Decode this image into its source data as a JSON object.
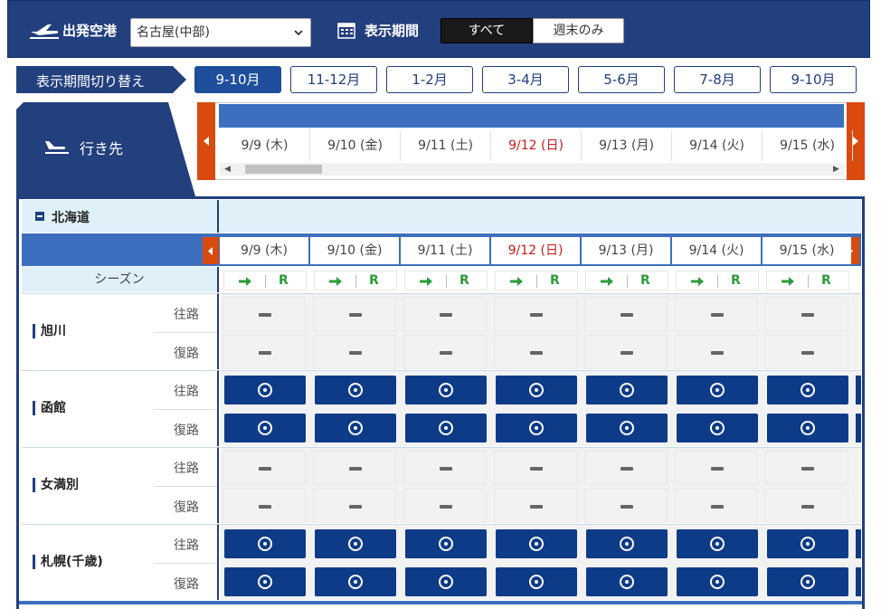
{
  "header": {
    "departure_label": "出発空港",
    "airport_value": "名古屋(中部)",
    "period_label": "表示期間",
    "toggle": [
      "すべて",
      "週末のみ"
    ],
    "toggle_active": "すべて"
  },
  "period_switch": {
    "label": "表示期間切り替え",
    "buttons": [
      "9-10月",
      "11-12月",
      "1-2月",
      "3-4月",
      "5-6月",
      "7-8月",
      "9-10月"
    ],
    "active_index": 0
  },
  "destination_tab": {
    "label": "行き先"
  },
  "dates": [
    {
      "label": "9/9 (木)",
      "sunday": false
    },
    {
      "label": "9/10 (金)",
      "sunday": false
    },
    {
      "label": "9/11 (土)",
      "sunday": false
    },
    {
      "label": "9/12 (日)",
      "sunday": true
    },
    {
      "label": "9/13 (月)",
      "sunday": false
    },
    {
      "label": "9/14 (火)",
      "sunday": false
    },
    {
      "label": "9/15 (水)",
      "sunday": false
    }
  ],
  "table": {
    "region": "北海道",
    "season_label": "シーズン",
    "season_r_label": "R",
    "outbound_label": "往路",
    "return_label": "復路",
    "destinations": [
      {
        "name": "旭川",
        "available": false
      },
      {
        "name": "函館",
        "available": true
      },
      {
        "name": "女満別",
        "available": false
      },
      {
        "name": "札幌(千歳)",
        "available": true
      }
    ]
  },
  "colors": {
    "navy": "#223f7e",
    "accent_blue": "#3d6fbe",
    "available": "#0e3b87",
    "arrow_orange": "#d94a0f",
    "sunday_red": "#c81a1a",
    "season_green": "#2d9b3b"
  }
}
